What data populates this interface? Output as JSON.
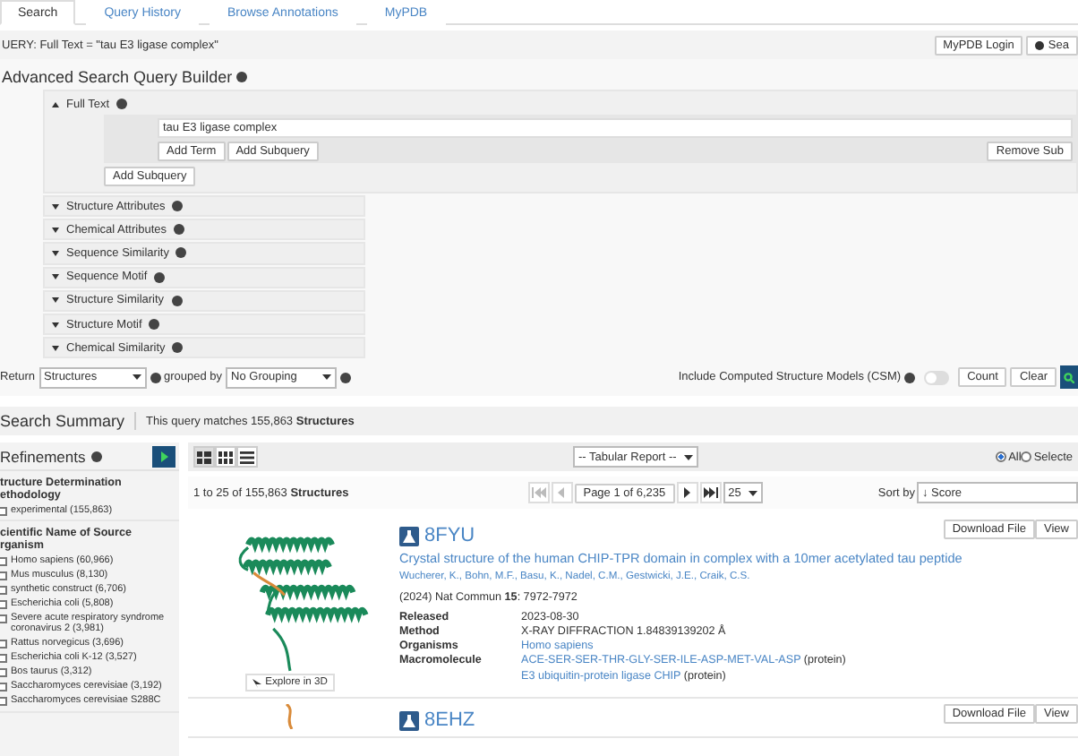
{
  "tabs": [
    {
      "label": "Search",
      "selected": true
    },
    {
      "label": "Query History",
      "selected": false
    },
    {
      "label": "Browse Annotations",
      "selected": false
    },
    {
      "label": "MyPDB",
      "selected": false
    }
  ],
  "query_bar": {
    "text": "UERY: Full Text = \"tau E3 ligase complex\"",
    "login_button": "MyPDB Login",
    "search_button": "Sea"
  },
  "builder": {
    "title": "Advanced Search Query Builder",
    "full_text": {
      "label": "Full Text",
      "expanded": true,
      "value": "tau E3 ligase complex",
      "add_term": "Add Term",
      "add_subquery_inner": "Add Subquery",
      "remove_subquery": "Remove Sub",
      "add_subquery": "Add Subquery"
    },
    "sections": [
      {
        "label": "Structure Attributes",
        "expanded": false
      },
      {
        "label": "Chemical Attributes",
        "expanded": false
      },
      {
        "label": "Sequence Similarity",
        "expanded": false
      },
      {
        "label": "Sequence Motif",
        "expanded": false
      },
      {
        "label": "Structure Similarity",
        "expanded": false
      },
      {
        "label": "Structure Motif",
        "expanded": false
      },
      {
        "label": "Chemical Similarity",
        "expanded": false
      }
    ],
    "return_label": "Return",
    "return_value": "Structures",
    "grouped_by_label": "grouped by",
    "grouping_value": "No Grouping",
    "csm_label": "Include Computed Structure Models (CSM)",
    "csm_on": false,
    "count_button": "Count",
    "clear_button": "Clear"
  },
  "summary": {
    "title": "Search Summary",
    "text": "This query matches 155,863 **Structures**"
  },
  "refinements": {
    "title": "Refinements",
    "groups": [
      {
        "title": "tructure Determination ethodology",
        "items": [
          {
            "label": "experimental (155,863)",
            "checked": false
          }
        ]
      },
      {
        "title": "cientific Name of Source rganism",
        "items": [
          {
            "label": "Homo sapiens (60,966)",
            "checked": false
          },
          {
            "label": "Mus musculus (8,130)",
            "checked": false
          },
          {
            "label": "synthetic construct (6,706)",
            "checked": false
          },
          {
            "label": "Escherichia coli (5,808)",
            "checked": false
          },
          {
            "label": "Severe acute respiratory syndrome coronavirus 2 (3,981)",
            "checked": false
          },
          {
            "label": "Rattus norvegicus (3,696)",
            "checked": false
          },
          {
            "label": "Escherichia coli K-12 (3,527)",
            "checked": false
          },
          {
            "label": "Bos taurus (3,312)",
            "checked": false
          },
          {
            "label": "Saccharomyces cerevisiae (3,192)",
            "checked": false
          },
          {
            "label": "Saccharomyces cerevisiae S288C",
            "checked": false
          }
        ]
      }
    ]
  },
  "results_toolbar": {
    "view_modes": [
      {
        "kind": "gallery",
        "selected": true
      },
      {
        "kind": "grid",
        "selected": false
      },
      {
        "kind": "list",
        "selected": false
      }
    ],
    "report_select": "-- Tabular Report --",
    "scope": [
      {
        "label": "All",
        "selected": true
      },
      {
        "label": "Selecte",
        "selected": false
      }
    ]
  },
  "pagination": {
    "range": "1 to 25 of 155,863 **Structures**",
    "page": "Page 1 of 6,235",
    "per_page": "25",
    "sort_label": "Sort by",
    "sort_value": "↓ Score",
    "buttons": [
      {
        "kind": "first",
        "disabled": true
      },
      {
        "kind": "prev",
        "disabled": true
      },
      {
        "kind": "next",
        "disabled": false
      },
      {
        "kind": "last",
        "disabled": false
      }
    ]
  },
  "results": [
    {
      "id": "8FYU",
      "download": "Download File",
      "view": "View",
      "explore": "Explore in 3D",
      "title": "Crystal structure of the human CHIP-TPR domain in complex with a 10mer acetylated tau peptide",
      "authors": "Wucherer, K., Bohn, M.F., Basu, K., Nadel, C.M., Gestwicki, J.E., Craik, C.S.",
      "citation": "(2024) Nat Commun **15**: 7972-7972",
      "released_label": "Released",
      "released": "2023-08-30",
      "method_label": "Method",
      "method": "X-RAY DIFFRACTION 1.84839139202 Å",
      "organisms_label": "Organisms",
      "organisms": "Homo sapiens",
      "macromolecule_label": "Macromolecule",
      "macromolecules": [
        {
          "name": "ACE-SER-SER-THR-GLY-SER-ILE-ASP-MET-VAL-ASP",
          "type": "(protein)"
        },
        {
          "name": "E3 ubiquitin-protein ligase CHIP",
          "type": "(protein)"
        }
      ]
    },
    {
      "id": "8EHZ",
      "download": "Download File",
      "view": "View"
    }
  ]
}
